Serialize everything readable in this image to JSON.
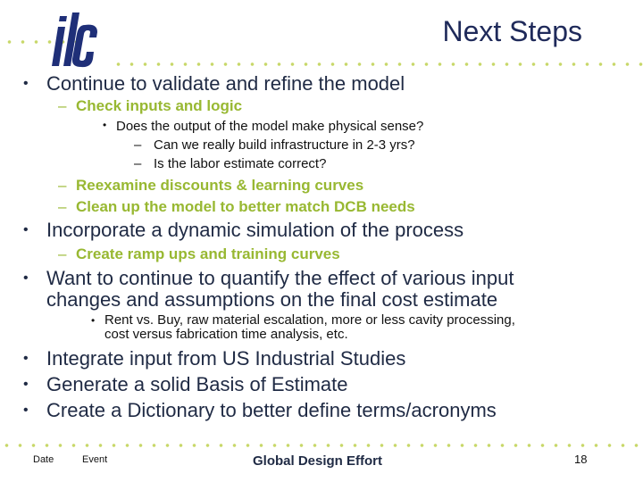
{
  "header": {
    "logo_text": "ilc",
    "title": "Next Steps"
  },
  "colors": {
    "title": "#1f2a5a",
    "body_text": "#1f2a44",
    "accent_green": "#98b832",
    "dots": "#c8d86a"
  },
  "content": {
    "item1": {
      "text": "Continue to validate and refine the model",
      "sub1": "Check inputs and logic",
      "sub1_bullet": "Does the output of the model make physical sense?",
      "sub1_dash1": "Can we really build infrastructure in 2-3 yrs?",
      "sub1_dash2": "Is the labor estimate correct?",
      "sub2": "Reexamine discounts & learning curves",
      "sub3": "Clean up the model to better match DCB needs"
    },
    "item2": {
      "text": "Incorporate a dynamic simulation of the process",
      "sub1": "Create ramp ups and training curves"
    },
    "item3": {
      "line1": "Want to continue to quantify the effect of various input",
      "line2": "changes and assumptions on the final cost estimate",
      "sub_line1": "Rent vs. Buy, raw material escalation, more or less cavity processing,",
      "sub_line2": "cost versus fabrication time analysis, etc."
    },
    "item4": "Integrate input from US Industrial Studies",
    "item5": "Generate a solid Basis of Estimate",
    "item6": "Create a Dictionary to better define terms/acronyms",
    "bullet": "•",
    "dash": "–"
  },
  "footer": {
    "date": "Date",
    "event": "Event",
    "center": "Global Design Effort",
    "page": "18"
  }
}
